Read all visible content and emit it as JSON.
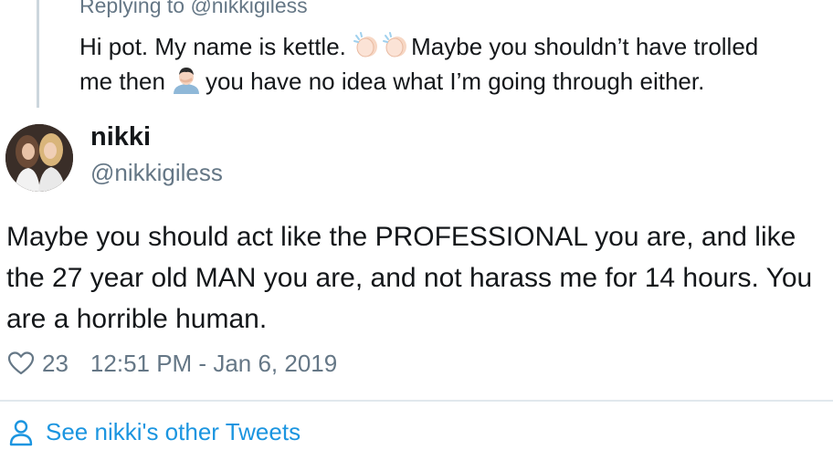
{
  "parent_tweet": {
    "replying_to": "Replying to @nikkigiless",
    "text_part1": "Hi pot. My name is kettle.",
    "text_part2": "Maybe you shouldn’t have trolled",
    "text_part3": "me then",
    "text_part4": "you have no idea what I’m going through either.",
    "emojis": [
      "clapping-hands",
      "clapping-hands",
      "man-facepalming"
    ]
  },
  "tweet": {
    "author_name": "nikki",
    "author_handle": "@nikkigiless",
    "text": "Maybe you should act like the PROFESSIONAL you are, and like the 27 year old MAN you are, and not harass me for 14 hours. You are a horrible human.",
    "like_count": "23",
    "timestamp": "12:51 PM - Jan 6, 2019"
  },
  "footer": {
    "see_other_label": "See nikki's other Tweets"
  },
  "colors": {
    "text": "#14171a",
    "secondary": "#657786",
    "link": "#1b95e0",
    "divider": "#e1e8ed"
  }
}
